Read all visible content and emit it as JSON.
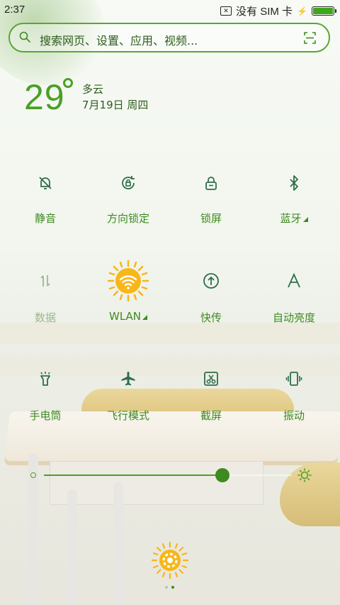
{
  "status_bar": {
    "time": "2:37",
    "sim_text": "没有 SIM 卡",
    "battery_level": 1.0,
    "battery_color": "#3ea61b"
  },
  "search": {
    "placeholder": "搜索网页、设置、应用、视频...",
    "icons": [
      "search-icon",
      "scan-icon"
    ]
  },
  "weather": {
    "temperature": "29",
    "condition": "多云",
    "date": "7月19日 周四"
  },
  "toggles": [
    {
      "label": "静音",
      "icon": "bell-off-icon",
      "active": true
    },
    {
      "label": "方向锁定",
      "icon": "rotation-lock-icon",
      "active": true
    },
    {
      "label": "锁屏",
      "icon": "lock-icon",
      "active": true
    },
    {
      "label": "蓝牙",
      "icon": "bluetooth-icon",
      "active": true,
      "has_more": true
    },
    {
      "label": "数据",
      "icon": "mobile-data-icon",
      "active": false
    },
    {
      "label": "WLAN",
      "icon": "wifi-sun-icon",
      "active": true,
      "has_more": true
    },
    {
      "label": "快传",
      "icon": "quick-transfer-icon",
      "active": true
    },
    {
      "label": "自动亮度",
      "icon": "auto-brightness-icon",
      "active": true
    },
    {
      "label": "手电筒",
      "icon": "flashlight-icon",
      "active": true
    },
    {
      "label": "飞行模式",
      "icon": "airplane-icon",
      "active": true
    },
    {
      "label": "截屏",
      "icon": "screenshot-icon",
      "active": true
    },
    {
      "label": "振动",
      "icon": "vibrate-icon",
      "active": true
    }
  ],
  "brightness": {
    "level": 0.72,
    "icons": [
      "brightness-low-icon",
      "brightness-high-icon"
    ]
  },
  "footer": {
    "settings_icon": "settings-sun-icon",
    "page_count": 2,
    "current_page": 2
  },
  "colors": {
    "accent": "#4aa026",
    "label": "#3f8a20",
    "inactive": "#9bb890",
    "sun": "#f6b51b"
  }
}
